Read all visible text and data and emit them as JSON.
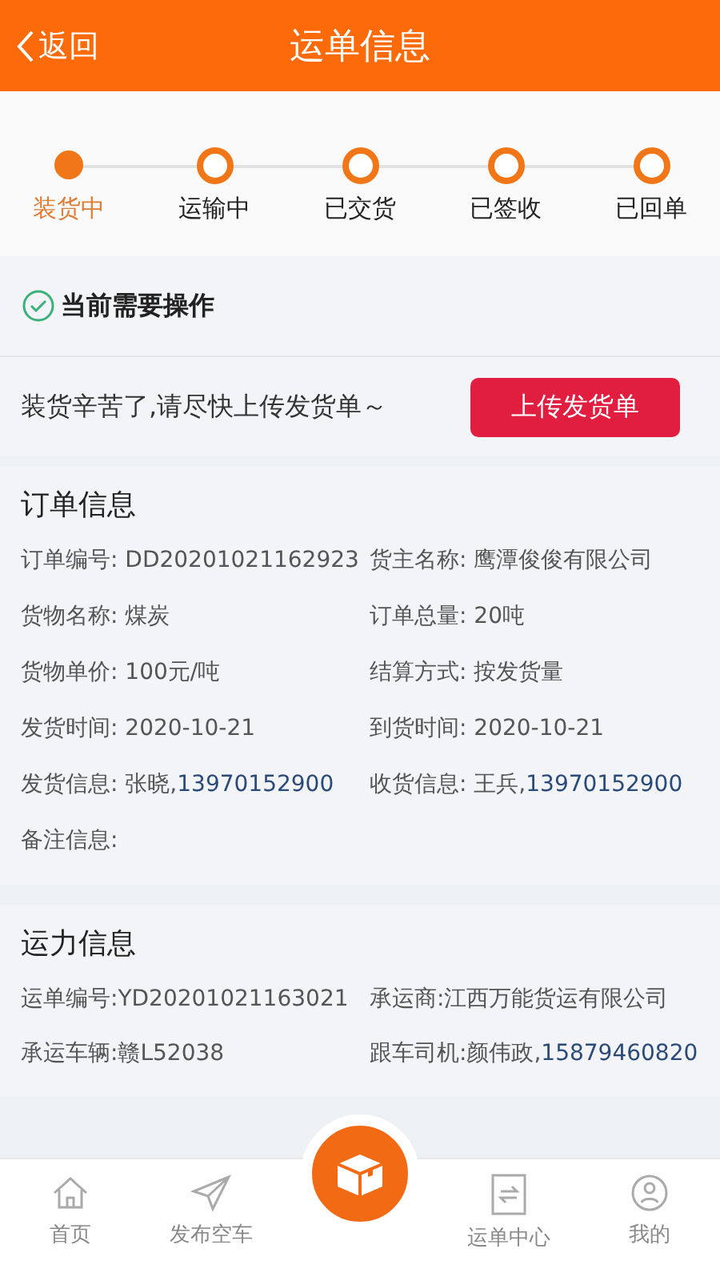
{
  "header": {
    "back": "返回",
    "title": "运单信息"
  },
  "steps": [
    {
      "label": "装货中",
      "selected": true
    },
    {
      "label": "运输中",
      "selected": false
    },
    {
      "label": "已交货",
      "selected": false
    },
    {
      "label": "已签收",
      "selected": false
    },
    {
      "label": "已回单",
      "selected": false
    }
  ],
  "action": {
    "title": "当前需要操作",
    "message": "装货辛苦了,请尽快上传发货单～",
    "button": "上传发货单"
  },
  "order_info": {
    "title": "订单信息",
    "fields": [
      {
        "label": "订单编号: ",
        "value": "DD20201021162923"
      },
      {
        "label": "货主名称: ",
        "value": "鹰潭俊俊有限公司"
      },
      {
        "label": "货物名称: ",
        "value": "煤炭"
      },
      {
        "label": "订单总量: ",
        "value": "20吨"
      },
      {
        "label": "货物单价: ",
        "value": "100元/吨"
      },
      {
        "label": "结算方式: ",
        "value": "按发货量"
      },
      {
        "label": "发货时间: ",
        "value": "2020-10-21"
      },
      {
        "label": "到货时间: ",
        "value": "2020-10-21"
      },
      {
        "label": "发货信息: ",
        "value": "张晓,",
        "phone": "13970152900"
      },
      {
        "label": "收货信息: ",
        "value": "王兵,",
        "phone": "13970152900"
      },
      {
        "label": "备注信息: "
      }
    ]
  },
  "transport_info": {
    "title": "运力信息",
    "fields": [
      {
        "label": "运单编号:",
        "value": "YD20201021163021"
      },
      {
        "label": "承运商:",
        "value": "江西万能货运有限公司"
      },
      {
        "label": "承运车辆:",
        "value": "赣L52038"
      },
      {
        "label": "跟车司机:",
        "value": "颜伟政,",
        "phone": "15879460820"
      }
    ]
  },
  "tab_bar": [
    {
      "kind": "home",
      "label": "首页"
    },
    {
      "kind": "send",
      "label": "发布空车"
    },
    {
      "kind": "center"
    },
    {
      "kind": "orders",
      "label": "运单中心"
    },
    {
      "kind": "profile",
      "label": "我的"
    }
  ]
}
